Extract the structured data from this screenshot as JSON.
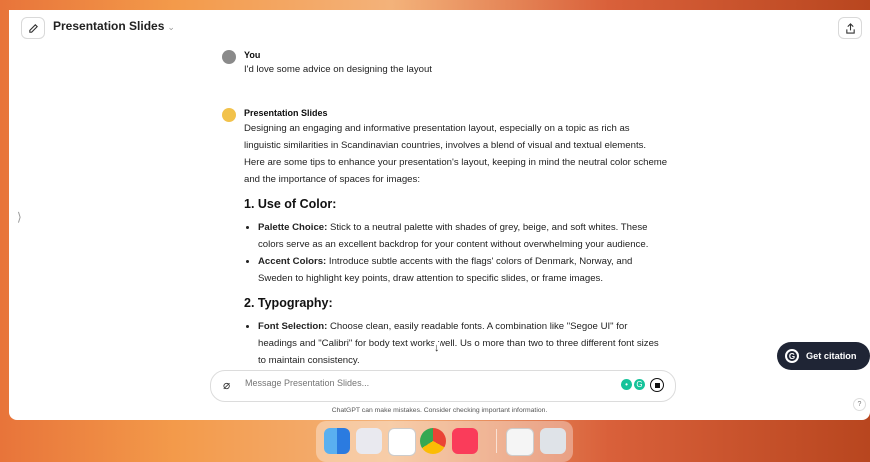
{
  "header": {
    "title": "Presentation Slides",
    "new_chat_icon": "edit-icon",
    "share_icon": "share-icon"
  },
  "user_message": {
    "author": "You",
    "text": "I'd love some advice on designing the layout"
  },
  "assistant_message": {
    "author": "Presentation Slides",
    "intro": "Designing an engaging and informative presentation layout, especially on a topic as rich as linguistic similarities in Scandinavian countries, involves a blend of visual and textual elements. Here are some tips to enhance your presentation's layout, keeping in mind the neutral color scheme and the importance of spaces for images:",
    "sections": [
      {
        "heading": "1. Use of Color:",
        "items": [
          {
            "label": "Palette Choice:",
            "text": " Stick to a neutral palette with shades of grey, beige, and soft whites. These colors serve as an excellent backdrop for your content without overwhelming your audience."
          },
          {
            "label": "Accent Colors:",
            "text": " Introduce subtle accents with the flags' colors of Denmark, Norway, and Sweden to highlight key points, draw attention to specific slides, or frame images."
          }
        ]
      },
      {
        "heading": "2. Typography:",
        "items": [
          {
            "label": "Font Selection:",
            "text": " Choose clean, easily readable fonts. A combination like \"Segoe UI\" for headings and \"Calibri\" for body text works well. Us   o more than two to three different font sizes to maintain consistency."
          }
        ]
      }
    ]
  },
  "composer": {
    "placeholder": "Message Presentation Slides..."
  },
  "disclaimer": "ChatGPT can make mistakes. Consider checking important information.",
  "citation_button": "Get citation",
  "help": "?",
  "dock": {
    "icons": [
      "finder-icon",
      "launchpad-icon",
      "reminders-icon",
      "chrome-icon",
      "music-icon",
      "preview-icon",
      "trash-icon"
    ]
  },
  "colors": {
    "citation_bg": "#1f2535",
    "grammarly_green": "#15c39a"
  }
}
